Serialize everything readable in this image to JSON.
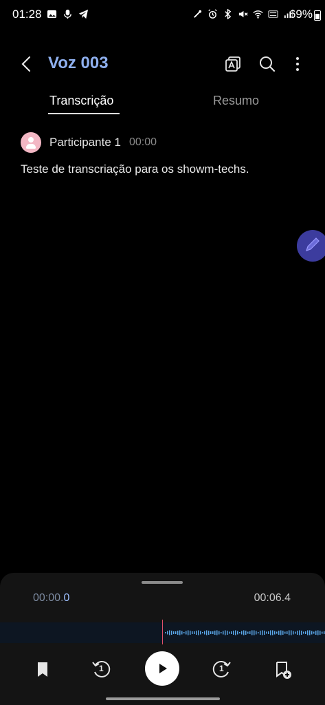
{
  "status_bar": {
    "time": "01:28",
    "battery": "69%",
    "left_icons": [
      "image-icon",
      "mic-icon",
      "telegram-icon"
    ],
    "right_icons": [
      "nfc-icon",
      "alarm-icon",
      "bluetooth-icon",
      "mute-icon",
      "wifi-icon",
      "volte-icon",
      "signal-icon"
    ]
  },
  "header": {
    "title": "Voz 003",
    "icons": [
      "translate-icon",
      "search-icon",
      "more-icon"
    ]
  },
  "tabs": [
    {
      "label": "Transcrição",
      "active": true
    },
    {
      "label": "Resumo",
      "active": false
    }
  ],
  "transcript": {
    "participant": "Participante 1",
    "timestamp": "00:00",
    "text": "Teste de transcriação para os showm-techs."
  },
  "player": {
    "current_time_prefix": "00:00.",
    "current_time_suffix": "0",
    "total_time": "00:06.4",
    "controls": [
      "bookmark-icon",
      "rewind-icon",
      "play-icon",
      "forward-icon",
      "add-bookmark-icon"
    ],
    "rewind_label": "1",
    "forward_label": "1"
  },
  "colors": {
    "background": "#000000",
    "title": "#8fb0ef",
    "avatar": "#f3b7c4",
    "fab": "#3c3c9e",
    "wave": "#5aa7e8",
    "playhead": "#e0506a"
  }
}
